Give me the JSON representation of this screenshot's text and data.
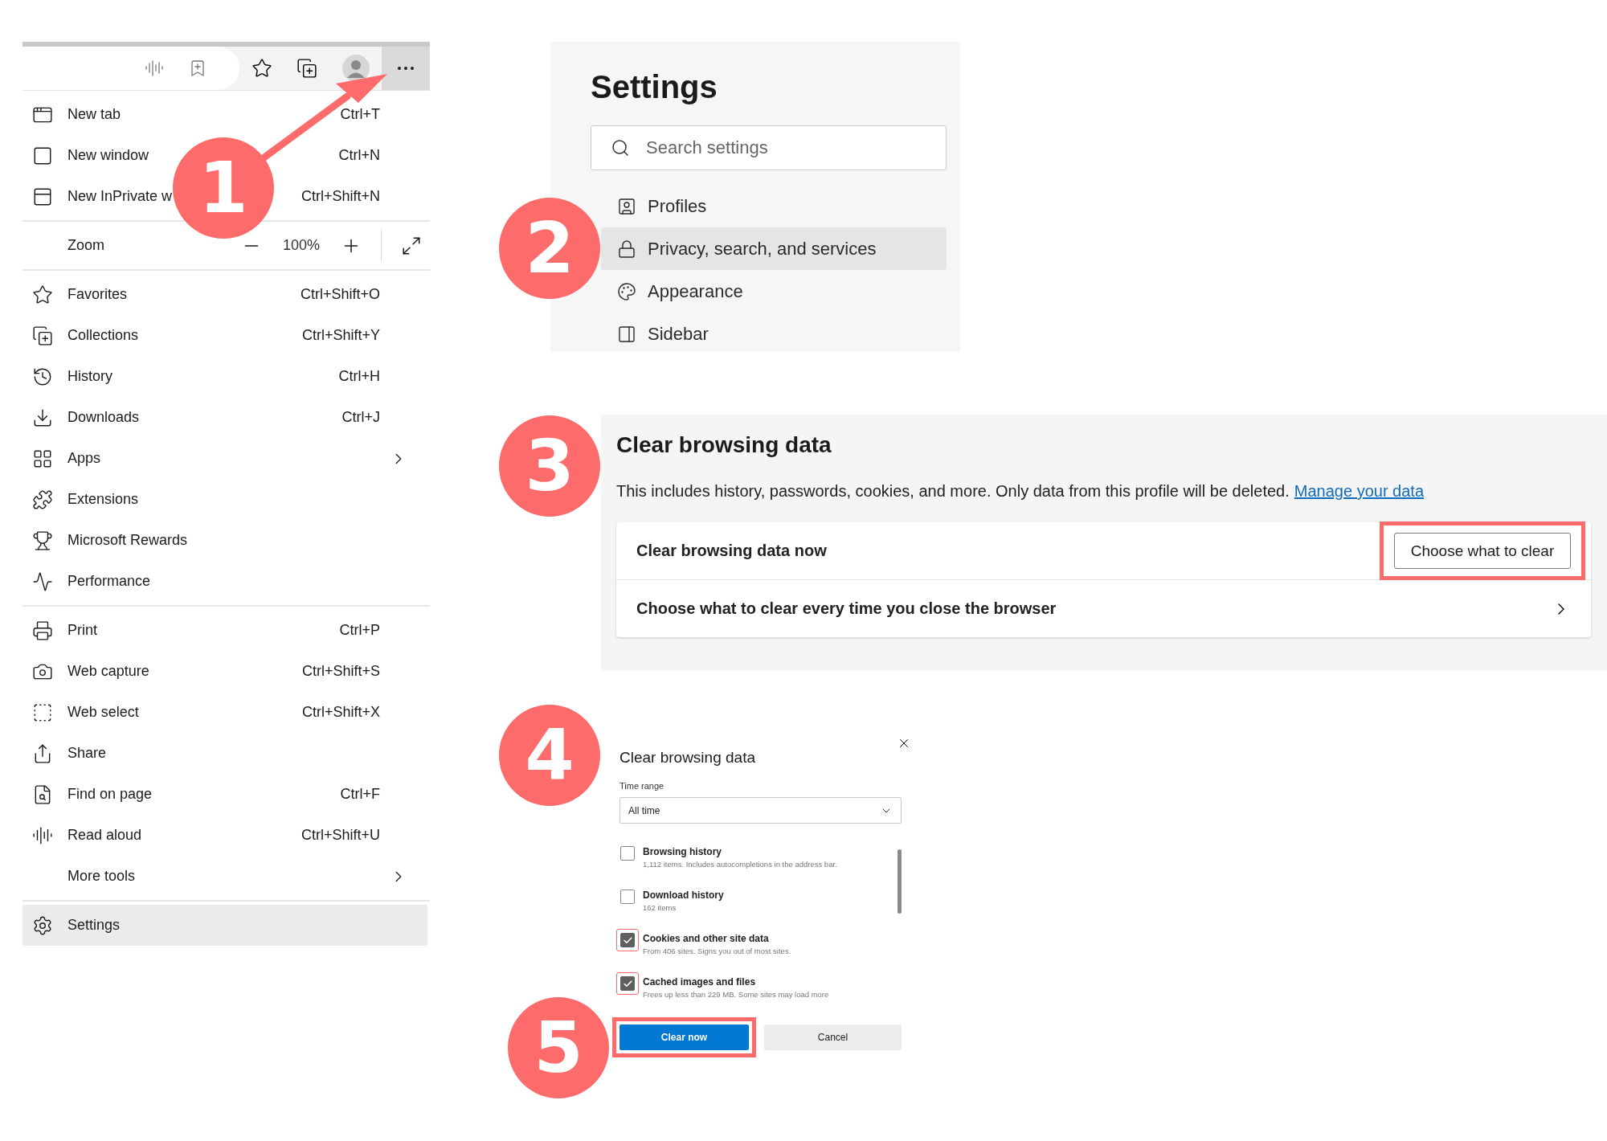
{
  "browser_menu": {
    "groups": [
      [
        {
          "kind": "command",
          "label": "New tab",
          "shortcut": "Ctrl+T",
          "submenu": false,
          "selected": false
        },
        {
          "kind": "command",
          "label": "New window",
          "shortcut": "Ctrl+N",
          "submenu": false,
          "selected": false
        },
        {
          "kind": "command",
          "label": "New InPrivate w",
          "shortcut": "Ctrl+Shift+N",
          "submenu": false,
          "selected": false
        }
      ],
      [
        {
          "kind": "zoom",
          "label": "Zoom",
          "value": "100%"
        }
      ],
      [
        {
          "kind": "command",
          "label": "Favorites",
          "shortcut": "Ctrl+Shift+O",
          "submenu": false,
          "selected": false
        },
        {
          "kind": "command",
          "label": "Collections",
          "shortcut": "Ctrl+Shift+Y",
          "submenu": false,
          "selected": false
        },
        {
          "kind": "command",
          "label": "History",
          "shortcut": "Ctrl+H",
          "submenu": false,
          "selected": false
        },
        {
          "kind": "command",
          "label": "Downloads",
          "shortcut": "Ctrl+J",
          "submenu": false,
          "selected": false
        },
        {
          "kind": "command",
          "label": "Apps",
          "submenu": true,
          "selected": false
        },
        {
          "kind": "command",
          "label": "Extensions",
          "submenu": false,
          "selected": false
        },
        {
          "kind": "command",
          "label": "Microsoft Rewards",
          "submenu": false,
          "selected": false
        },
        {
          "kind": "command",
          "label": "Performance",
          "submenu": false,
          "selected": false
        }
      ],
      [
        {
          "kind": "command",
          "label": "Print",
          "shortcut": "Ctrl+P",
          "submenu": false,
          "selected": false
        },
        {
          "kind": "command",
          "label": "Web capture",
          "shortcut": "Ctrl+Shift+S",
          "submenu": false,
          "selected": false
        },
        {
          "kind": "command",
          "label": "Web select",
          "shortcut": "Ctrl+Shift+X",
          "submenu": false,
          "selected": false
        },
        {
          "kind": "command",
          "label": "Share",
          "submenu": false,
          "selected": false
        },
        {
          "kind": "command",
          "label": "Find on page",
          "shortcut": "Ctrl+F",
          "submenu": false,
          "selected": false
        },
        {
          "kind": "command",
          "label": "Read aloud",
          "shortcut": "Ctrl+Shift+U",
          "submenu": false,
          "selected": false
        },
        {
          "kind": "command",
          "label": "More tools",
          "submenu": true,
          "selected": false
        }
      ],
      [
        {
          "kind": "command",
          "label": "Settings",
          "submenu": false,
          "selected": true
        }
      ]
    ]
  },
  "settings": {
    "title": "Settings",
    "search": {
      "placeholder": "Search settings"
    },
    "nav": [
      {
        "label": "Profiles",
        "selected": false
      },
      {
        "label": "Privacy, search, and services",
        "selected": true
      },
      {
        "label": "Appearance",
        "selected": false
      },
      {
        "label": "Sidebar",
        "selected": false
      }
    ]
  },
  "clear_section": {
    "title": "Clear browsing data",
    "description": "This includes history, passwords, cookies, and more. Only data from this profile will be deleted.",
    "link": "Manage your data",
    "rows": [
      {
        "kind": "button",
        "label": "Clear browsing data now",
        "button": {
          "label": "Choose what to clear",
          "highlighted": true
        }
      },
      {
        "kind": "link",
        "label": "Choose what to clear every time you close the browser"
      }
    ]
  },
  "dialog": {
    "title": "Clear browsing data",
    "time_range": {
      "label": "Time range",
      "value": "All time"
    },
    "options": [
      {
        "label": "Browsing history",
        "detail": "1,112 items. Includes autocompletions in the address bar.",
        "checked": false,
        "highlighted": false
      },
      {
        "label": "Download history",
        "detail": "162 items",
        "checked": false,
        "highlighted": false
      },
      {
        "label": "Cookies and other site data",
        "detail": "From 406 sites. Signs you out of most sites.",
        "checked": true,
        "highlighted": true
      },
      {
        "label": "Cached images and files",
        "detail": "Frees up less than 229 MB. Some sites may load more",
        "checked": true,
        "highlighted": true
      }
    ],
    "buttons": [
      {
        "kind": "primary",
        "label": "Clear now",
        "highlighted": true
      },
      {
        "kind": "secondary",
        "label": "Cancel",
        "highlighted": false
      }
    ]
  },
  "steps": [
    {
      "label": "1"
    },
    {
      "label": "2"
    },
    {
      "label": "3"
    },
    {
      "label": "4"
    },
    {
      "label": "5"
    }
  ]
}
